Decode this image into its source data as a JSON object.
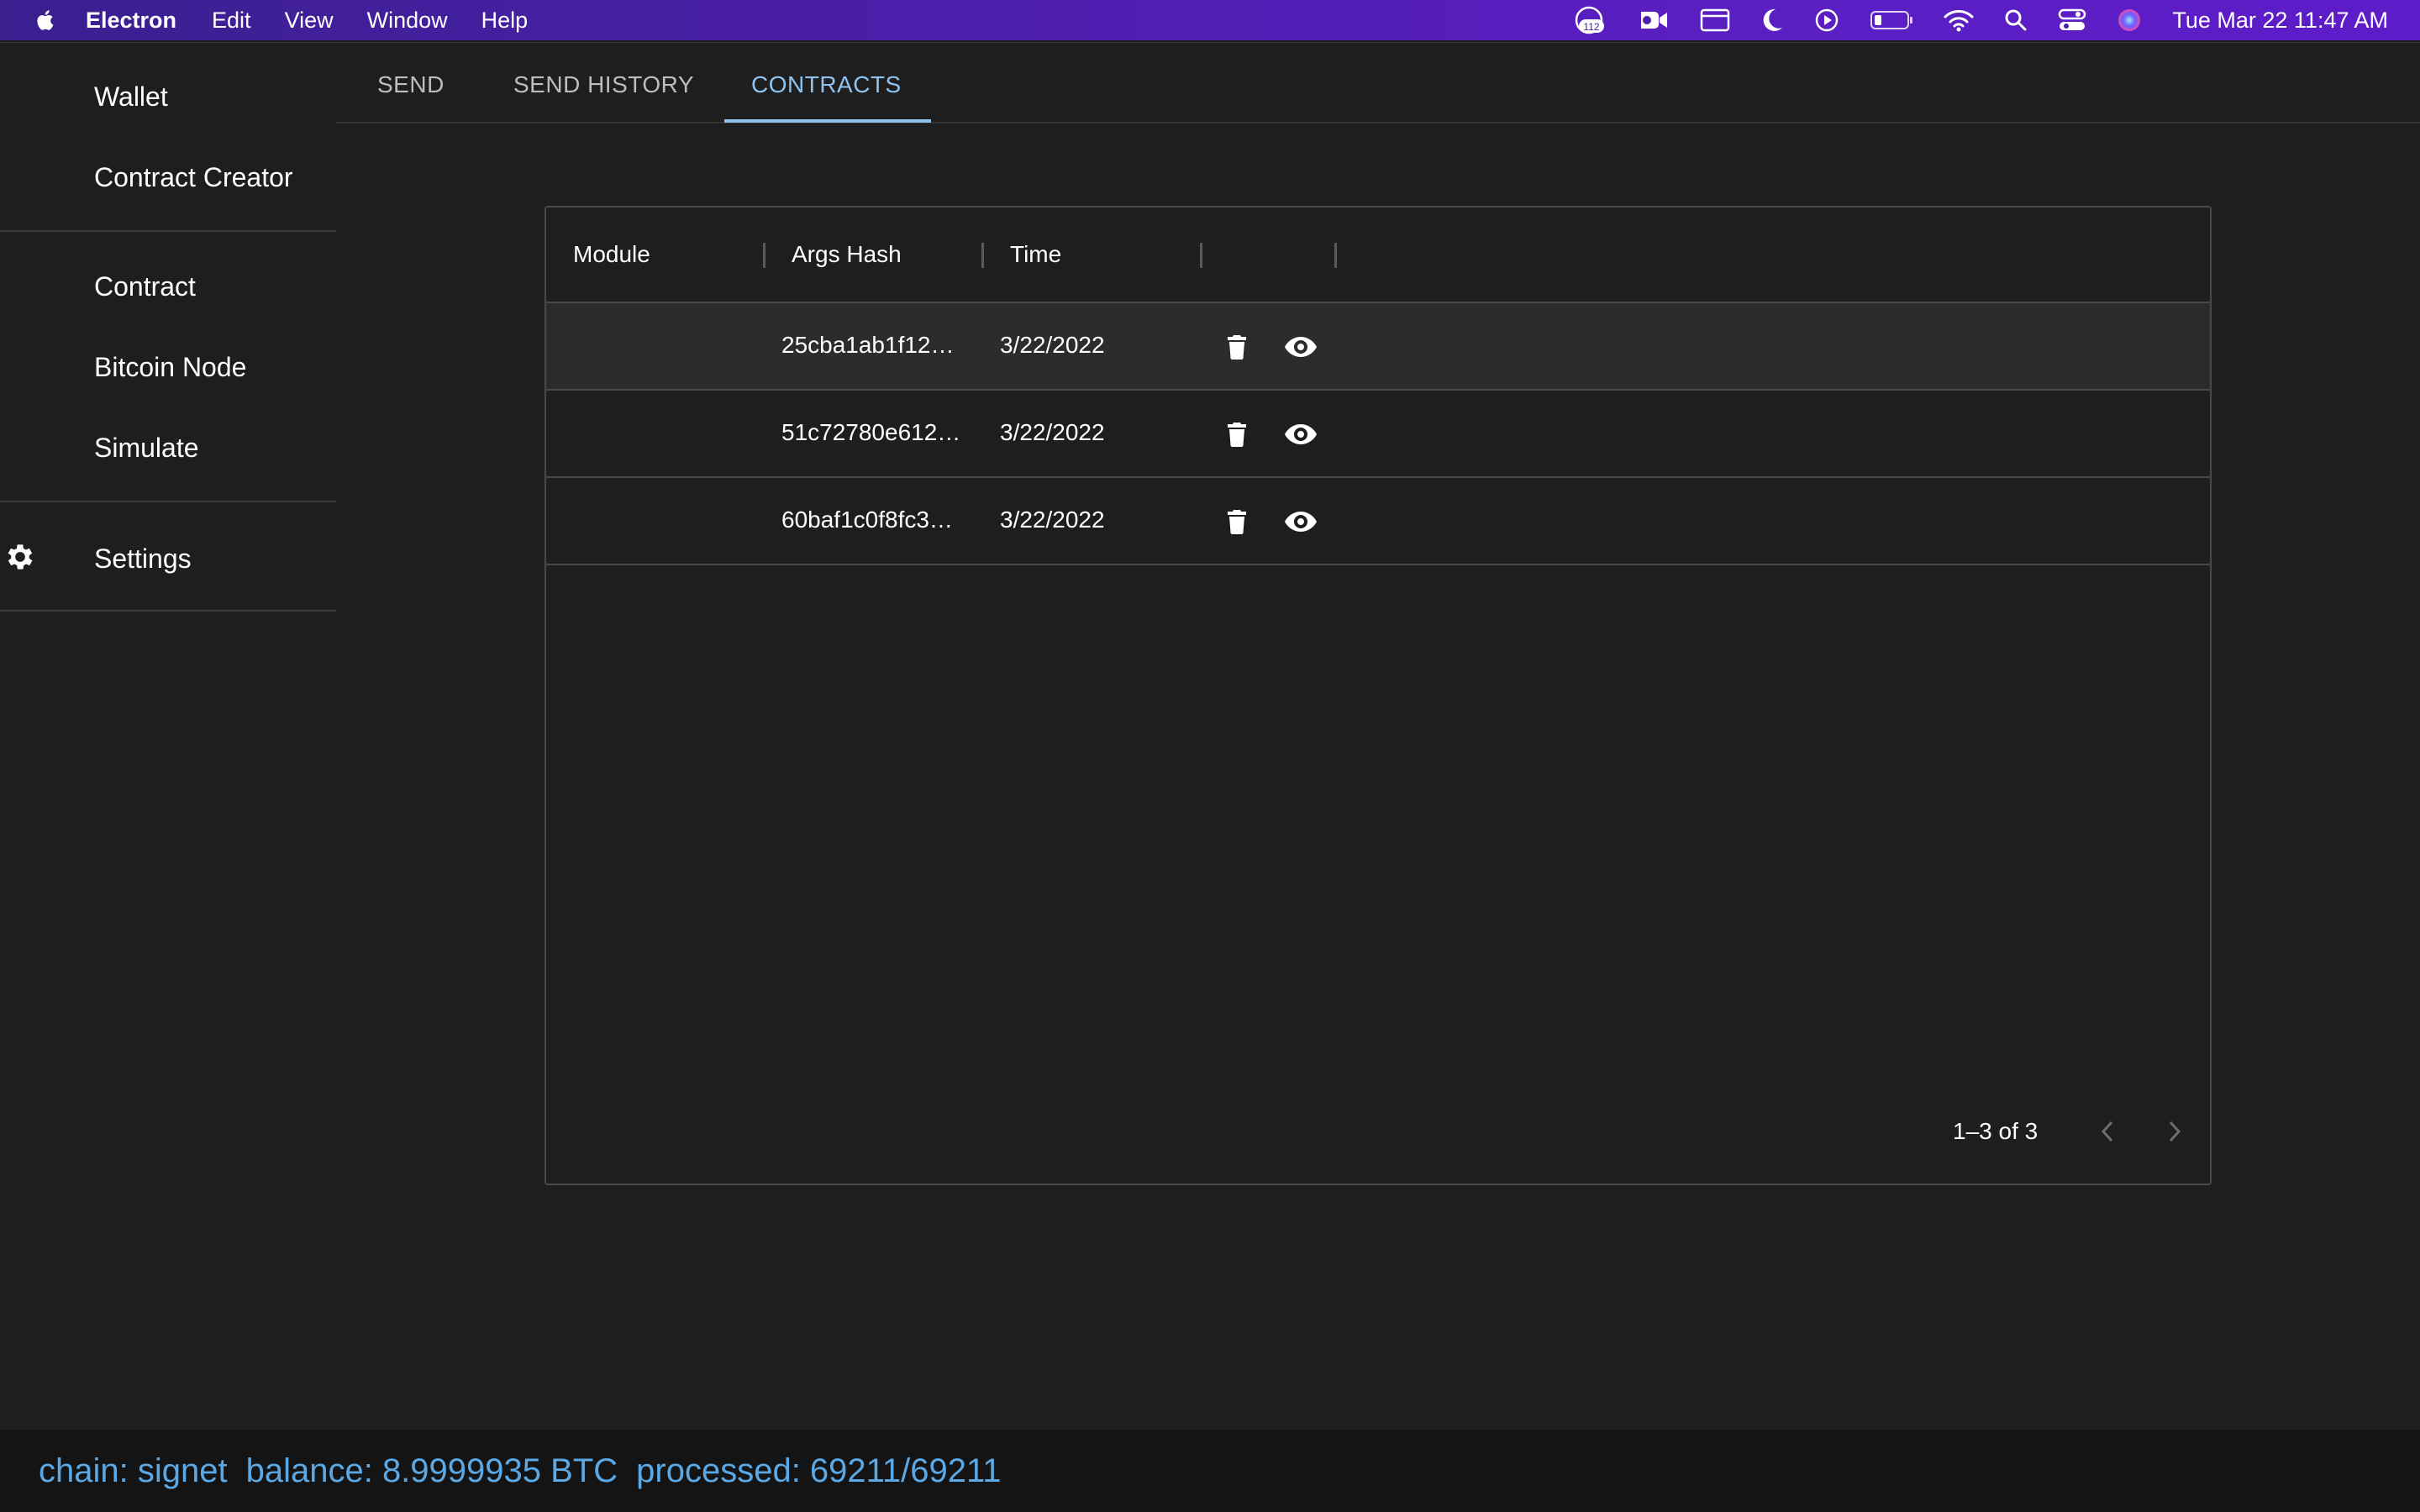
{
  "menubar": {
    "app_name": "Electron",
    "menus": [
      "Edit",
      "View",
      "Window",
      "Help"
    ],
    "status_icons": [
      "notification-badge-icon",
      "video-call-icon",
      "window-icon",
      "moon-icon",
      "play-icon",
      "battery-icon",
      "wifi-icon",
      "search-icon",
      "control-center-icon",
      "siri-icon"
    ],
    "notification_count": "112",
    "clock": "Tue Mar 22  11:47 AM"
  },
  "sidebar": {
    "items": [
      {
        "label": "Wallet"
      },
      {
        "label": "Contract Creator"
      },
      {
        "label": "Contract"
      },
      {
        "label": "Bitcoin Node"
      },
      {
        "label": "Simulate"
      },
      {
        "label": "Settings",
        "icon": "gear-icon"
      }
    ]
  },
  "tabs": [
    {
      "label": "SEND",
      "active": false
    },
    {
      "label": "SEND HISTORY",
      "active": false
    },
    {
      "label": "CONTRACTS",
      "active": true
    }
  ],
  "table": {
    "columns": [
      "Module",
      "Args Hash",
      "Time",
      ""
    ],
    "rows": [
      {
        "module": "",
        "args_hash": "25cba1ab1f12…",
        "time": "3/22/2022"
      },
      {
        "module": "",
        "args_hash": "51c72780e612…",
        "time": "3/22/2022"
      },
      {
        "module": "",
        "args_hash": "60baf1c0f8fc3…",
        "time": "3/22/2022"
      }
    ],
    "row_actions": [
      "delete-icon",
      "view-icon"
    ],
    "pagination": {
      "label": "1–3 of 3"
    }
  },
  "status_bar": {
    "chain": "chain: signet",
    "balance": "balance: 8.9999935 BTC",
    "processed": "processed: 69211/69211"
  },
  "colors": {
    "accent": "#90c2f0",
    "status_text": "#5aa9e6",
    "background": "#1e1e1e"
  }
}
